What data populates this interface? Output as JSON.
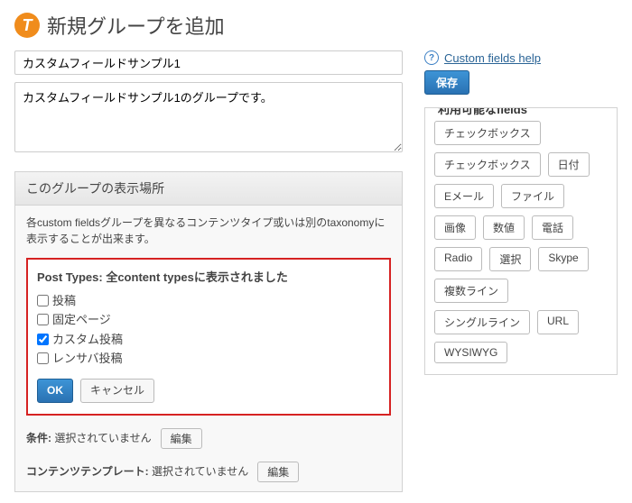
{
  "header": {
    "title": "新規グループを追加"
  },
  "form": {
    "name_value": "カスタムフィールドサンプル1",
    "desc_value": "カスタムフィールドサンプル1のグループです。"
  },
  "panel": {
    "title": "このグループの表示場所",
    "description": "各custom fieldsグループを異なるコンテンツタイプ或いは別のtaxonomyに表示することが出来ます。"
  },
  "post_types": {
    "title": "Post Types: 全content typesに表示されました",
    "items": [
      {
        "label": "投稿",
        "checked": false
      },
      {
        "label": "固定ページ",
        "checked": false
      },
      {
        "label": "カスタム投稿",
        "checked": true
      },
      {
        "label": "レンサバ投稿",
        "checked": false
      }
    ],
    "ok": "OK",
    "cancel": "キャンセル"
  },
  "conditions": {
    "label": "条件:",
    "value": "選択されていません",
    "edit": "編集"
  },
  "template": {
    "label": "コンテンツテンプレート:",
    "value": "選択されていません",
    "edit": "編集"
  },
  "sidebar": {
    "help_link": "Custom fields help",
    "save": "保存",
    "fields_title": "利用可能なfields",
    "fields": [
      "チェックボックス",
      "チェックボックス",
      "日付",
      "Eメール",
      "ファイル",
      "画像",
      "数値",
      "電話",
      "Radio",
      "選択",
      "Skype",
      "複数ライン",
      "シングルライン",
      "URL",
      "WYSIWYG"
    ]
  }
}
